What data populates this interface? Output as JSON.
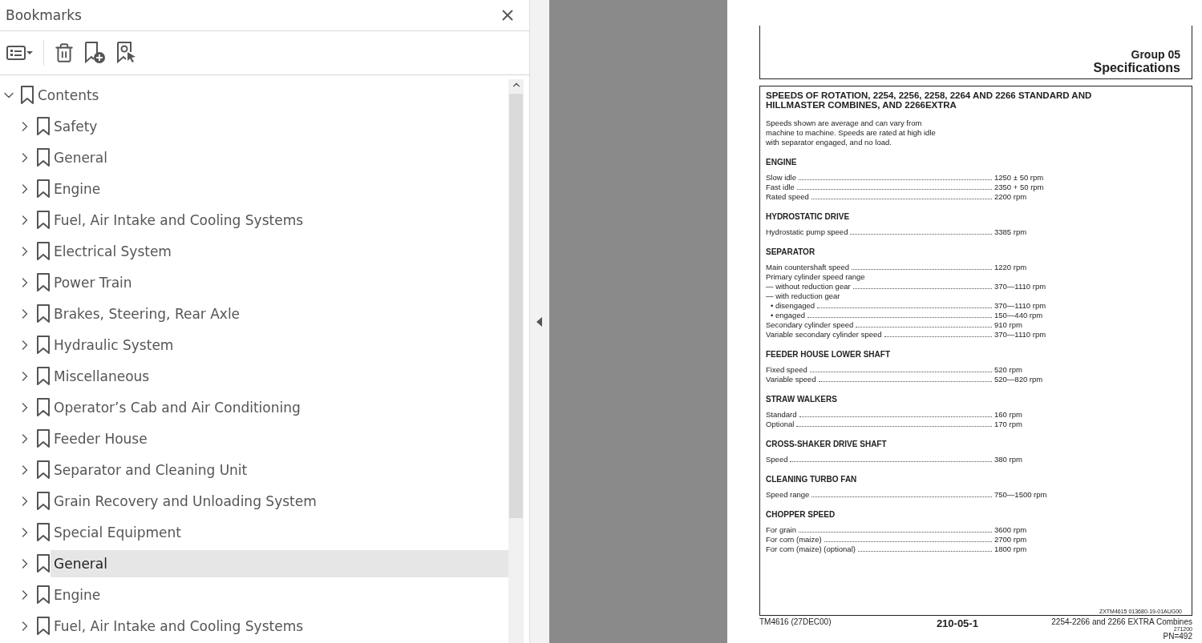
{
  "panel": {
    "title": "Bookmarks"
  },
  "bookmarks": [
    {
      "label": "Contents",
      "expanded": true,
      "selected": false,
      "children": [
        {
          "label": "Safety",
          "expanded": false,
          "selected": false
        },
        {
          "label": "General",
          "expanded": false,
          "selected": false
        },
        {
          "label": "Engine",
          "expanded": false,
          "selected": false
        },
        {
          "label": "Fuel, Air Intake and Cooling Systems",
          "expanded": false,
          "selected": false
        },
        {
          "label": "Electrical System",
          "expanded": false,
          "selected": false
        },
        {
          "label": "Power Train",
          "expanded": false,
          "selected": false
        },
        {
          "label": "Brakes, Steering, Rear Axle",
          "expanded": false,
          "selected": false
        },
        {
          "label": "Hydraulic System",
          "expanded": false,
          "selected": false
        },
        {
          "label": "Miscellaneous",
          "expanded": false,
          "selected": false
        },
        {
          "label": "Operator’s Cab and Air Conditioning",
          "expanded": false,
          "selected": false
        },
        {
          "label": "Feeder House",
          "expanded": false,
          "selected": false
        },
        {
          "label": "Separator and Cleaning Unit",
          "expanded": false,
          "selected": false
        },
        {
          "label": "Grain Recovery and Unloading System",
          "expanded": false,
          "selected": false
        },
        {
          "label": "Special Equipment",
          "expanded": false,
          "selected": false
        },
        {
          "label": "General",
          "expanded": false,
          "selected": true
        },
        {
          "label": "Engine",
          "expanded": false,
          "selected": false
        },
        {
          "label": "Fuel, Air Intake and Cooling Systems",
          "expanded": false,
          "selected": false
        }
      ]
    }
  ],
  "page": {
    "group": "Group 05",
    "heading": "Specifications",
    "title": "SPEEDS OF ROTATION, 2254, 2256, 2258, 2264 AND 2266 STANDARD AND HILLMASTER COMBINES, AND 2266EXTRA",
    "intro": "Speeds shown are average and can vary from machine to machine. Speeds are rated at high idle with separator engaged, and no load.",
    "sections": [
      {
        "title": "ENGINE",
        "rows": [
          {
            "label": "Slow idle",
            "value": "1250 ± 50 rpm"
          },
          {
            "label": "Fast idle",
            "value": "2350 + 50 rpm"
          },
          {
            "label": "Rated speed",
            "value": "2200 rpm"
          }
        ]
      },
      {
        "title": "HYDROSTATIC DRIVE",
        "rows": [
          {
            "label": "Hydrostatic pump speed",
            "value": "3385 rpm"
          }
        ]
      },
      {
        "title": "SEPARATOR",
        "rows": [
          {
            "label": "Main countershaft speed",
            "value": "1220 rpm"
          },
          {
            "label": "Primary cylinder speed range"
          },
          {
            "label": "— without reduction gear",
            "value": "370—1110 rpm"
          },
          {
            "label": "— with reduction gear",
            "children": [
              {
                "label": "• disengaged",
                "value": "370—1110 rpm"
              },
              {
                "label": "• engaged",
                "value": "150—440 rpm"
              }
            ]
          },
          {
            "label": "Secondary cylinder speed",
            "value": "910 rpm"
          },
          {
            "label": "Variable secondary cylinder speed",
            "value": "370—1110 rpm"
          }
        ]
      },
      {
        "title": "FEEDER HOUSE LOWER SHAFT",
        "rows": [
          {
            "label": "Fixed speed",
            "value": "520 rpm"
          },
          {
            "label": "Variable speed",
            "value": "520—820 rpm"
          }
        ]
      },
      {
        "title": "STRAW WALKERS",
        "rows": [
          {
            "label": "Standard",
            "value": "160 rpm"
          },
          {
            "label": "Optional",
            "value": "170 rpm"
          }
        ]
      },
      {
        "title": "CROSS-SHAKER DRIVE SHAFT",
        "rows": [
          {
            "label": "Speed",
            "value": "380 rpm"
          }
        ]
      },
      {
        "title": "CLEANING TURBO FAN",
        "rows": [
          {
            "label": "Speed range",
            "value": "750—1500 rpm"
          }
        ]
      },
      {
        "title": "CHOPPER SPEED",
        "rows": [
          {
            "label": "For grain",
            "value": "3600 rpm"
          },
          {
            "label": "For corn (maize)",
            "value": "2700 rpm"
          },
          {
            "label": "For corn (maize) (optional)",
            "value": "1800 rpm"
          }
        ]
      }
    ],
    "ref_code": "ZXTM4615 013680-19-01AUG00",
    "footer_left": "TM4616 (27DEC00)",
    "footer_center": "210-05-1",
    "footer_right": "2254-2266 and 2266 EXTRA Combines",
    "footer_date": "271200",
    "footer_pn": "PN=492"
  }
}
